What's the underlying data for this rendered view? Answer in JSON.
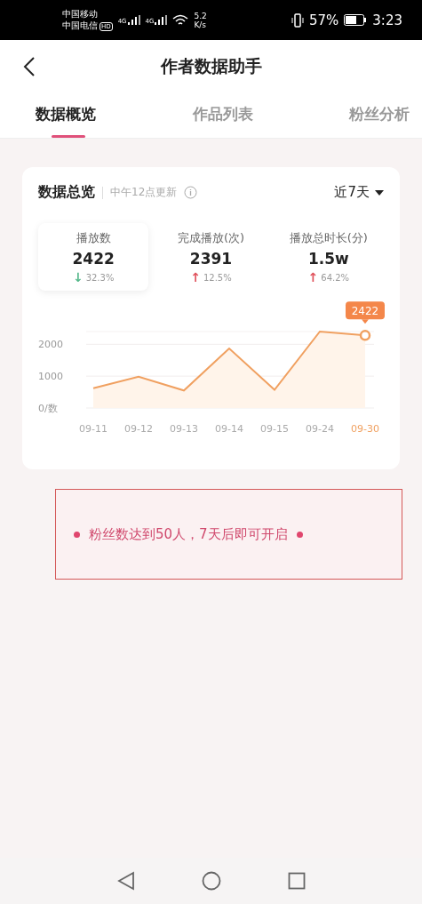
{
  "status_bar": {
    "carriers": [
      "中国移动",
      "中国电信"
    ],
    "hd_badge": "HD",
    "network": [
      "4G",
      "4G"
    ],
    "speed": [
      "5.2",
      "K/s"
    ],
    "battery": "57%",
    "time": "3:23"
  },
  "header": {
    "title": "作者数据助手"
  },
  "tabs": [
    {
      "label": "数据概览",
      "selected": true
    },
    {
      "label": "作品列表",
      "selected": false
    },
    {
      "label": "粉丝分析",
      "selected": false
    }
  ],
  "overview": {
    "title": "数据总览",
    "update_note": "中午12点更新",
    "range": "近7天",
    "metrics": [
      {
        "label": "播放数",
        "value": "2422",
        "arrow": "↓",
        "color": "#55b88a",
        "change": "32.3%",
        "selected": true
      },
      {
        "label": "完成播放(次)",
        "value": "2391",
        "arrow": "↑",
        "color": "#e0505a",
        "change": "12.5%",
        "selected": false
      },
      {
        "label": "播放总时长(分)",
        "value": "1.5w",
        "arrow": "↑",
        "color": "#e0505a",
        "change": "64.2%",
        "selected": false
      }
    ],
    "chart_data": {
      "type": "area",
      "categories": [
        "09-11",
        "09-12",
        "09-13",
        "09-14",
        "09-15",
        "09-24",
        "09-30"
      ],
      "series": [
        {
          "color": "#f0a060",
          "values": [
            620,
            980,
            550,
            1870,
            570,
            2400,
            2280
          ]
        }
      ],
      "ylim": [
        0,
        2400
      ],
      "yticks": [
        {
          "value": 0,
          "label": "0/数"
        },
        1000,
        2000
      ],
      "annotations": [
        "2422"
      ]
    }
  },
  "notice": {
    "text": "粉丝数达到50人，7天后即可开启"
  }
}
